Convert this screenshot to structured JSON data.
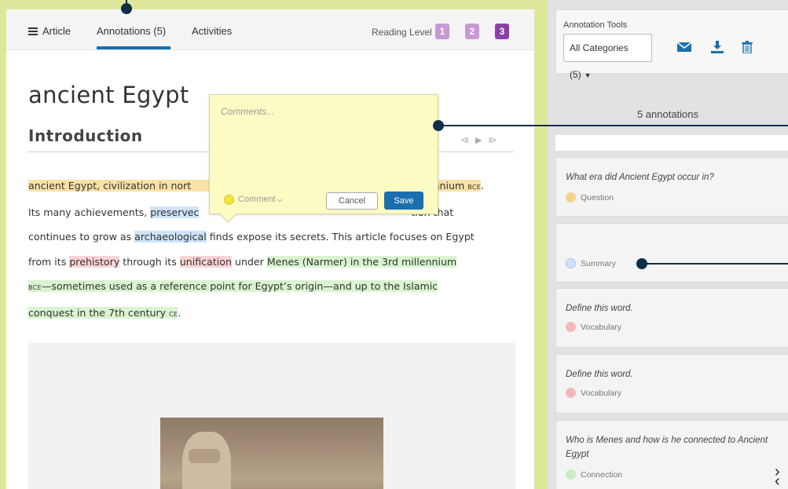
{
  "tabs": {
    "article": "Article",
    "annotations": "Annotations (5)",
    "activities": "Activities"
  },
  "reading_level": {
    "label": "Reading Level",
    "levels": [
      "1",
      "2",
      "3"
    ],
    "selected": "3"
  },
  "article": {
    "title": "ancient Egypt",
    "section": "Introduction",
    "paragraph": {
      "p1": "ancient Egypt,  civilization in nort",
      "p2": "illennium ",
      "era_bce": "BCE",
      "p3": "Its many achievements, ",
      "p4": "preservec",
      "p5": "tion that",
      "p6": "continues to grow as ",
      "p7": "archaeological",
      "p8": " finds expose its secrets. This article focuses on Egypt",
      "p9": "from its ",
      "p10": "prehistory",
      "p11": " through its ",
      "p12": "unification",
      "p13": " under ",
      "p14": "Menes (Narmer) in the 3rd millennium",
      "p15": "—sometimes used as a reference point for Egypt’s origin—and up to the Islamic",
      "p16": "conquest in the 7th century ",
      "era_ce": "CE",
      "p17": "."
    }
  },
  "comment_popup": {
    "placeholder": "Comments...",
    "category": "Comment",
    "cancel": "Cancel",
    "save": "Save"
  },
  "annotation_tools": {
    "label": "Annotation Tools",
    "category_filter": "All Categories (5)",
    "count_label": "5 annotations"
  },
  "annotations": [
    {
      "text": "What era did Ancient Egypt occur in?",
      "category": "Question",
      "color": "#f5d48a"
    },
    {
      "text": "",
      "category": "Summary",
      "color": "#cfe2f7"
    },
    {
      "text": "Define this word.",
      "category": "Vocabulary",
      "color": "#f5b8b8"
    },
    {
      "text": "Define this word.",
      "category": "Vocabulary",
      "color": "#f5b8b8"
    },
    {
      "text": "Who is Menes and how is he connected to Ancient Egypt",
      "category": "Connection",
      "color": "#c7eec0"
    }
  ],
  "colors": {
    "accent": "#1b6fae",
    "level_selected": "#8b3fa8",
    "level_unselected": "#c999d4",
    "callout": "#0f2f48",
    "background": "#dfe79a"
  }
}
